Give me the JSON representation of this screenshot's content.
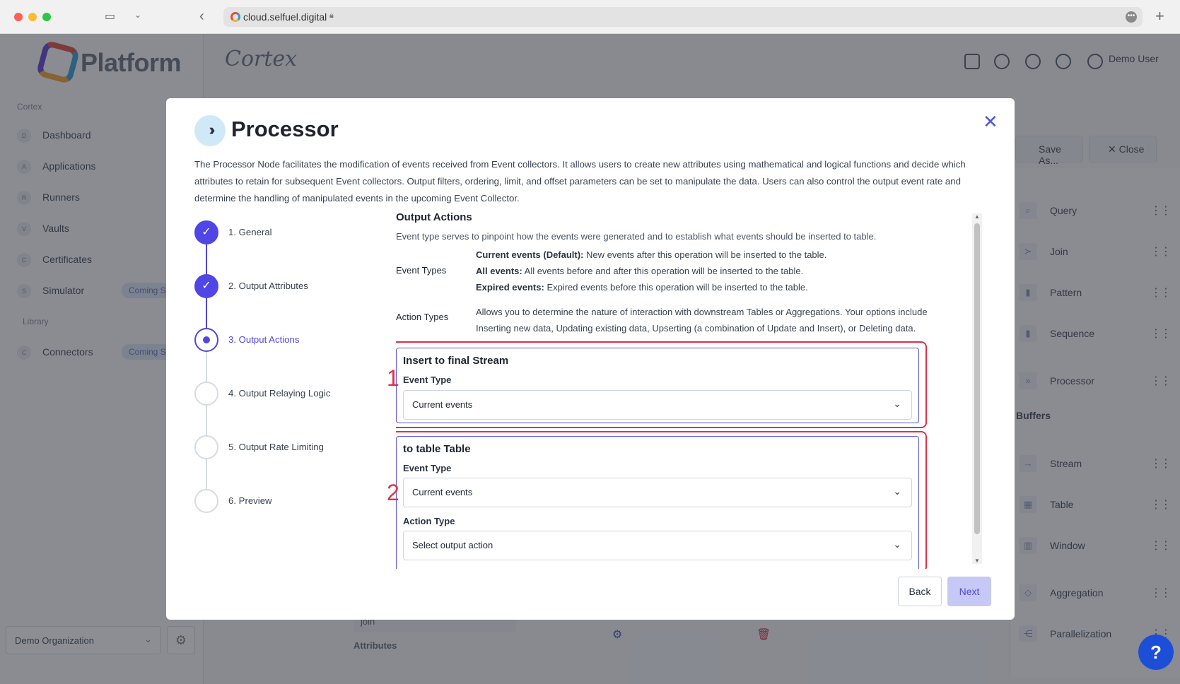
{
  "browser": {
    "url": "cloud.selfuel.digital"
  },
  "sidebar": {
    "logo_text": "Platform",
    "section_cortex": "Cortex",
    "section_library": "Library",
    "items": [
      {
        "letter": "D",
        "label": "Dashboard"
      },
      {
        "letter": "A",
        "label": "Applications"
      },
      {
        "letter": "R",
        "label": "Runners"
      },
      {
        "letter": "V",
        "label": "Vaults"
      },
      {
        "letter": "C",
        "label": "Certificates"
      },
      {
        "letter": "S",
        "label": "Simulator",
        "badge": "Coming Soon"
      }
    ],
    "library_items": [
      {
        "letter": "C",
        "label": "Connectors",
        "badge": "Coming Soon"
      }
    ],
    "org": "Demo Organization"
  },
  "topbar": {
    "product": "Cortex",
    "user": "Demo User",
    "save_as": "Save As...",
    "close": "Close"
  },
  "right_panel": {
    "items": [
      "Query",
      "Join",
      "Pattern",
      "Sequence",
      "Processor"
    ],
    "buffers_header": "Buffers",
    "buffers": [
      "Stream",
      "Table",
      "Window",
      "Aggregation",
      "Parallelization"
    ]
  },
  "canvas": {
    "node_label": "join",
    "attributes_label": "Attributes"
  },
  "modal": {
    "title": "Processor",
    "description": "The Processor Node facilitates the modification of events received from Event collectors. It allows users to create new attributes using mathematical and logical functions and decide which attributes to retain for subsequent Event collectors. Output filters, ordering, limit, and offset parameters can be set to manipulate the data. Users can also control the output event rate and determine the handling of manipulated events in the upcoming Event Collector.",
    "steps": [
      {
        "label": "1. General",
        "state": "done"
      },
      {
        "label": "2. Output Attributes",
        "state": "done"
      },
      {
        "label": "3. Output Actions",
        "state": "active"
      },
      {
        "label": "4. Output Relaying Logic",
        "state": "todo"
      },
      {
        "label": "5. Output Rate Limiting",
        "state": "todo"
      },
      {
        "label": "6. Preview",
        "state": "todo"
      }
    ],
    "section": {
      "title": "Output Actions",
      "subtitle": "Event type serves to pinpoint how the events were generated and to establish what events should be inserted to table.",
      "event_types_key": "Event Types",
      "event_types": [
        {
          "name": "Current events (Default):",
          "text": " New events after this operation will be inserted to the table."
        },
        {
          "name": "All events:",
          "text": " All events before and after this operation will be inserted to the table."
        },
        {
          "name": "Expired events:",
          "text": " Expired events before this operation will be inserted to the table."
        }
      ],
      "action_types_key": "Action Types",
      "action_types_text": "Allows you to determine the nature of interaction with downstream Tables or Aggregations. Your options include Inserting new data, Updating existing data, Upserting (a combination of Update and Insert), or Deleting data."
    },
    "card1": {
      "number": "1",
      "title": "Insert to final Stream",
      "event_type_label": "Event Type",
      "event_type_value": "Current events"
    },
    "card2": {
      "number": "2",
      "title": "to table Table",
      "event_type_label": "Event Type",
      "event_type_value": "Current events",
      "action_type_label": "Action Type",
      "action_type_value": "Select output action"
    },
    "back_label": "Back",
    "next_label": "Next"
  },
  "help_fab": "?"
}
